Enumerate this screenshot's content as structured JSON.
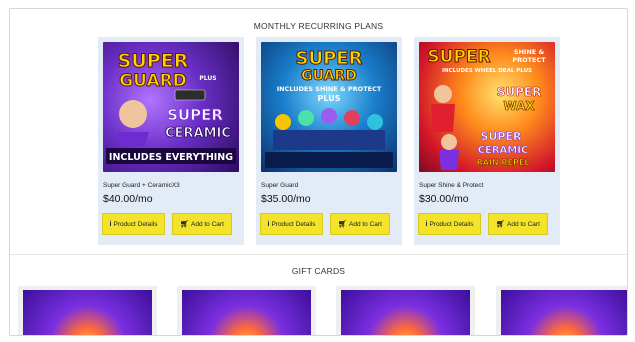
{
  "plans_section": {
    "title": "MONTHLY RECURRING PLANS"
  },
  "plans": [
    {
      "name": "Super Guard + CeramicX3",
      "price": "$40.00/mo",
      "details_label": "Product Details",
      "cart_label": "Add to Cart",
      "art": {
        "line1": "SUPER",
        "line2": "GUARD",
        "small": "PLUS",
        "line3": "SUPER",
        "line4": "CERAMIC",
        "banner": "INCLUDES EVERYTHING"
      }
    },
    {
      "name": "Super Guard",
      "price": "$35.00/mo",
      "details_label": "Product Details",
      "cart_label": "Add to Cart",
      "art": {
        "line1": "SUPER",
        "line2": "GUARD",
        "banner": "INCLUDES SHINE & PROTECT",
        "small": "PLUS"
      }
    },
    {
      "name": "Super Shine & Protect",
      "price": "$30.00/mo",
      "details_label": "Product Details",
      "cart_label": "Add to Cart",
      "art": {
        "line1": "SUPER",
        "small1": "SHINE &",
        "small2": "PROTECT",
        "banner": "INCLUDES WHEEL DEAL PLUS",
        "line3": "SUPER",
        "line4": "WAX",
        "line5": "SUPER",
        "line6": "CERAMIC",
        "line7": "RAIN REPEL"
      }
    }
  ],
  "gift_section": {
    "title": "GIFT CARDS"
  },
  "gift_cards": [
    {
      "label": "gift-card-1"
    },
    {
      "label": "gift-card-2"
    },
    {
      "label": "gift-card-3"
    },
    {
      "label": "gift-card-4"
    }
  ],
  "colors": {
    "button": "#f3e32b",
    "card_bg": "#e2ebf6",
    "text": "#222222"
  },
  "icons": {
    "details": "info-icon",
    "cart": "cart-icon"
  }
}
